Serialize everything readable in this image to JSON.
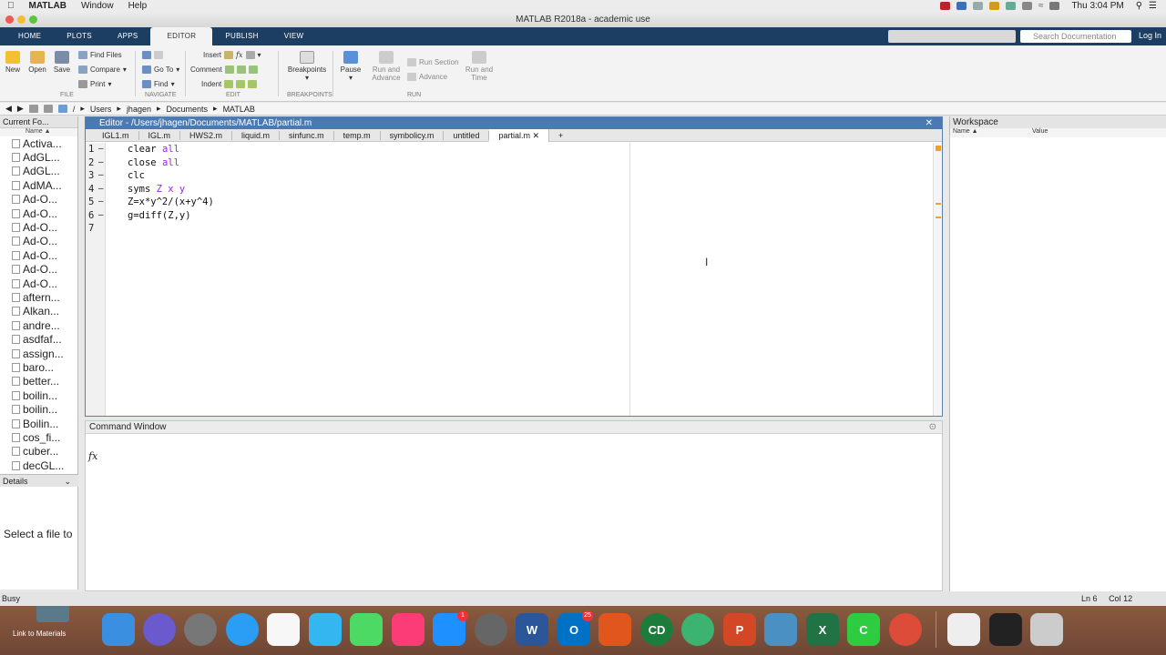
{
  "menubar": {
    "items": [
      "MATLAB",
      "Window",
      "Help"
    ],
    "clock": "Thu 3:04 PM"
  },
  "window": {
    "title": "MATLAB R2018a - academic use"
  },
  "ribbon_tabs": [
    "HOME",
    "PLOTS",
    "APPS",
    "EDITOR",
    "PUBLISH",
    "VIEW"
  ],
  "search": {
    "placeholder": "Search Documentation"
  },
  "login_label": "Log In",
  "ribbon": {
    "file": {
      "new": "New",
      "open": "Open",
      "save": "Save",
      "find_files": "Find Files",
      "compare": "Compare",
      "print": "Print",
      "section": "FILE"
    },
    "navigate": {
      "go_to": "Go To",
      "find": "Find",
      "section": "NAVIGATE"
    },
    "edit": {
      "insert": "Insert",
      "comment": "Comment",
      "indent": "Indent",
      "section": "EDIT"
    },
    "breakpoints": {
      "label": "Breakpoints",
      "section": "BREAKPOINTS"
    },
    "run": {
      "pause": "Pause",
      "run_and_advance": "Run and Advance",
      "run_section": "Run Section",
      "advance": "Advance",
      "run_and_time": "Run and Time",
      "section": "RUN"
    }
  },
  "address": {
    "path": [
      "/",
      "Users",
      "jhagen",
      "Documents",
      "MATLAB"
    ]
  },
  "current_folder": {
    "title": "Current Fo...",
    "col_name": "Name ▲",
    "files": [
      "Activa...",
      "AdGL...",
      "AdGL...",
      "AdMA...",
      "Ad-O...",
      "Ad-O...",
      "Ad-O...",
      "Ad-O...",
      "Ad-O...",
      "Ad-O...",
      "Ad-O...",
      "aftern...",
      "Alkan...",
      "andre...",
      "asdfaf...",
      "assign...",
      "baro...",
      "better...",
      "boilin...",
      "boilin...",
      "Boilin...",
      "cos_fi...",
      "cuber...",
      "decGL..."
    ],
    "details_label": "Details",
    "select_hint": "Select a file to"
  },
  "editor": {
    "title": "Editor - /Users/jhagen/Documents/MATLAB/partial.m",
    "tabs": [
      "IGL1.m",
      "IGL.m",
      "HWS2.m",
      "liquid.m",
      "sinfunc.m",
      "temp.m",
      "symbolicy.m",
      "untitled",
      "partial.m"
    ],
    "active_tab": "partial.m",
    "lines": [
      "1",
      "2",
      "3",
      "4",
      "5",
      "6",
      "7"
    ],
    "code": {
      "l1a": "clear ",
      "l1b": "all",
      "l2a": "close ",
      "l2b": "all",
      "l3": "clc",
      "l4a": "syms ",
      "l4b": "Z x y",
      "l5": "Z=x*y^2/(x+y^4)",
      "l6": "g=diff(Z,y)"
    }
  },
  "command_window": {
    "title": "Command Window",
    "prompt": "fx"
  },
  "workspace": {
    "title": "Workspace",
    "col_name": "Name ▲",
    "col_value": "Value"
  },
  "status": {
    "text": "Busy",
    "line_label": "Ln",
    "line": "6",
    "col_label": "Col",
    "col": "12"
  },
  "dock": {
    "link_label": "Link to Materials",
    "badges": {
      "appstore": "1",
      "outlook": "25"
    }
  }
}
